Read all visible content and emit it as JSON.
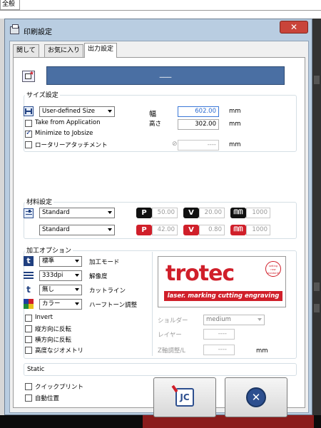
{
  "background": {
    "tab_label": "全般"
  },
  "window": {
    "title": "印刷設定",
    "close_symbol": "✕"
  },
  "tabs": [
    {
      "label": "関して"
    },
    {
      "label": "お気に入り"
    },
    {
      "label": "出力設定"
    }
  ],
  "job": {
    "name": "___"
  },
  "size": {
    "group_label": "サイズ設定",
    "mode": "User-defined Size",
    "width_label": "幅",
    "width_value": "602.00",
    "height_label": "高さ",
    "height_value": "302.00",
    "unit": "mm",
    "take_from_app": "Take from Application",
    "minimize": "Minimize to Jobsize",
    "rotary": "ロータリーアタッチメント",
    "rotary_value": "----",
    "rotary_unit": "mm"
  },
  "material": {
    "group_label": "材料設定",
    "rows": [
      {
        "material": "Standard",
        "p": "50.00",
        "v": "20.00",
        "freq": "1000"
      },
      {
        "material": "Standard",
        "p": "42.00",
        "v": "0.80",
        "freq": "1000"
      }
    ]
  },
  "process": {
    "group_label": "加工オプション",
    "mode_value": "標準",
    "mode_label": "加工モード",
    "dpi_value": "333dpi",
    "dpi_label": "解像度",
    "cutline_value": "無し",
    "cutline_label": "カットライン",
    "halftone_value": "カラー",
    "halftone_label": "ハーフトーン調整",
    "invert": "Invert",
    "flip_v": "縦方向に反転",
    "flip_h": "横方向に反転",
    "advanced": "高度なジオメトリ",
    "shoulder_label": "ショルダー",
    "shoulder_value": "medium",
    "layer_label": "レイヤー",
    "layer_value": "----",
    "z_label": "Z軸調整/L",
    "z_value": "----",
    "z_unit": "mm"
  },
  "logo": {
    "brand": "trotec",
    "tagline": "laser. marking cutting engraving",
    "seal": "setting new standards"
  },
  "static": {
    "label": "Static"
  },
  "bottom": {
    "quick_print": "クイックプリント",
    "auto_position": "自動位置"
  },
  "colors": {
    "accent_bar": "#4a6fa3",
    "red": "#d01f2a",
    "title_bg": "#b9cde1"
  }
}
